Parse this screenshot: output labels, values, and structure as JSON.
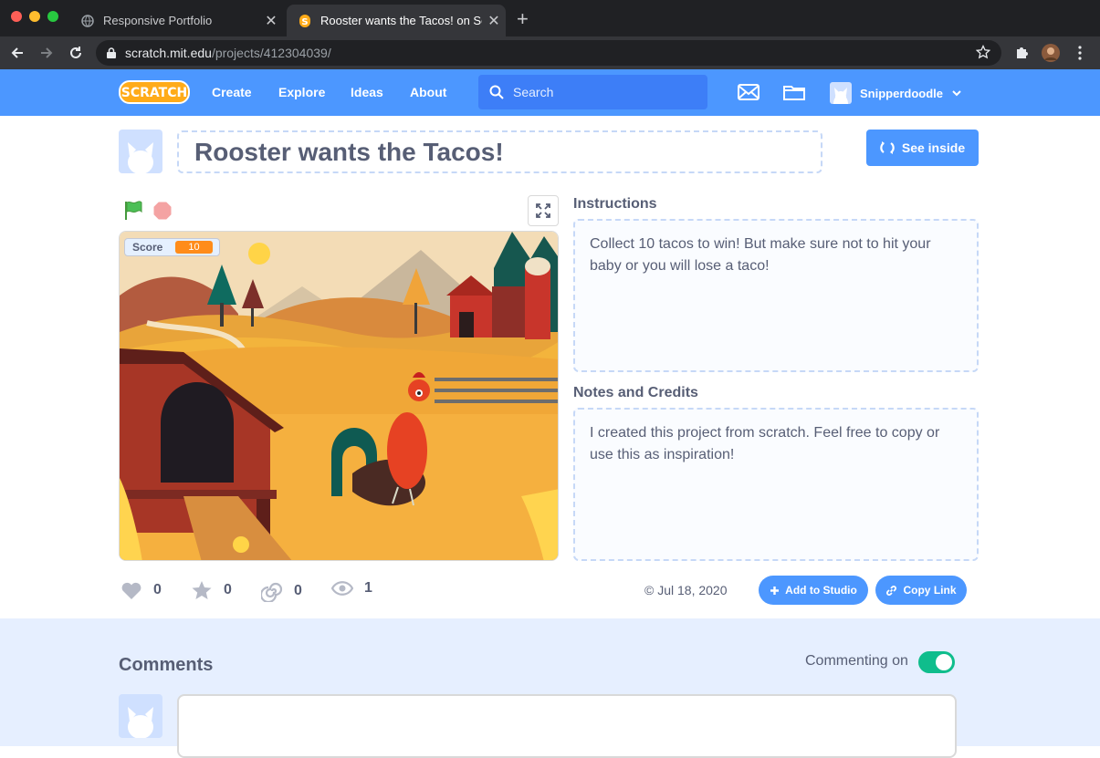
{
  "browser": {
    "tabs": [
      {
        "title": "Responsive Portfolio",
        "active": false
      },
      {
        "title": "Rooster wants the Tacos! on Scratch",
        "active": true
      }
    ],
    "url_host": "scratch.mit.edu",
    "url_path": "/projects/412304039/",
    "traffic_colors": [
      "#ff5f57",
      "#febc2e",
      "#28c840"
    ]
  },
  "nav": {
    "logo_text": "SCRATCH",
    "links": [
      "Create",
      "Explore",
      "Ideas",
      "About"
    ],
    "search_placeholder": "Search",
    "username": "Snipperdoodle"
  },
  "project": {
    "title": "Rooster wants the Tacos!",
    "see_inside_label": "See inside",
    "score_label": "Score",
    "score_value": "10",
    "instructions_label": "Instructions",
    "instructions_text": "Collect 10 tacos to win! But make sure not to hit your baby or you will lose a taco!",
    "notes_label": "Notes and Credits",
    "notes_text": "I created this project from scratch. Feel free to copy or use this as inspiration!",
    "stats": {
      "loves": "0",
      "favorites": "0",
      "remixes": "0",
      "views": "1"
    },
    "date": "© Jul 18, 2020",
    "add_to_studio_label": "Add to Studio",
    "copy_link_label": "Copy Link"
  },
  "comments": {
    "title": "Comments",
    "commenting_label": "Commenting on",
    "commenting_enabled": true
  },
  "colors": {
    "scratch_blue": "#4c97ff",
    "text": "#575e75",
    "toggle_on": "#0fbd8c",
    "score_orange": "#ff8c1a"
  }
}
